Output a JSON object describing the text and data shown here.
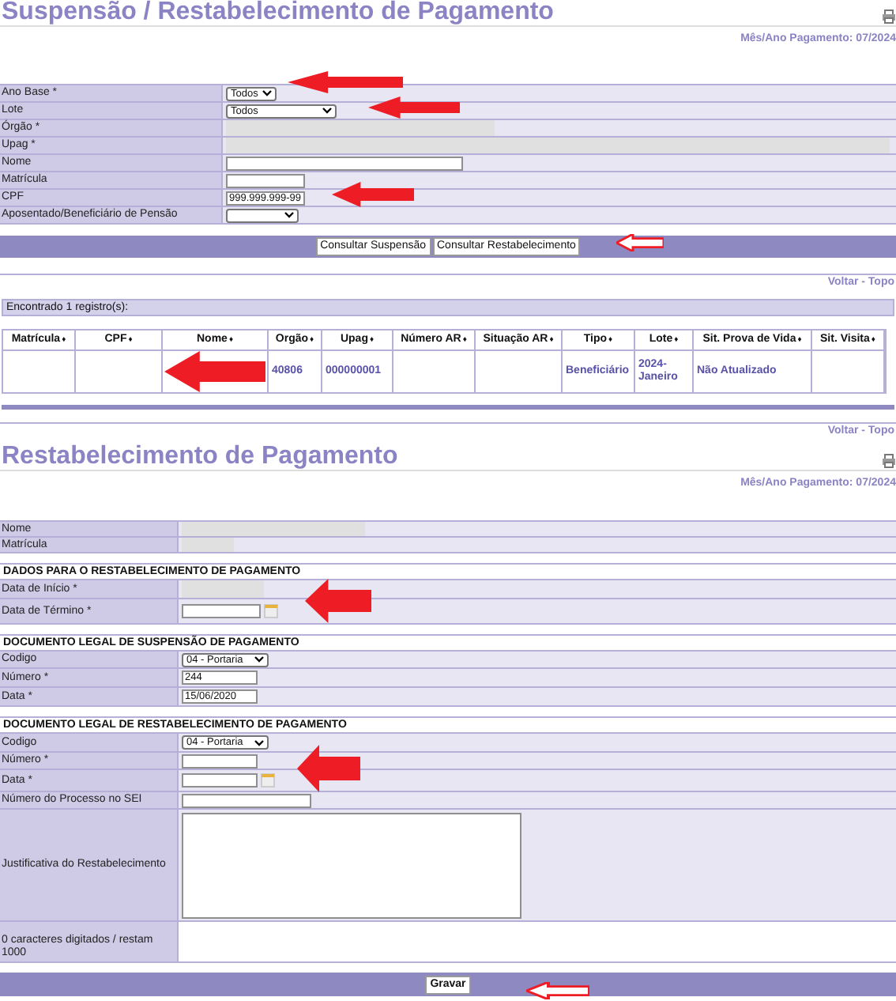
{
  "title": "Suspensão / Restabelecimento de Pagamento",
  "period": "Mês/Ano Pagamento: 07/2024",
  "filter_form": {
    "rows": [
      {
        "label": "Ano Base *",
        "kind": "select",
        "value": "Todos"
      },
      {
        "label": "Lote",
        "kind": "select",
        "value": "Todos"
      },
      {
        "label": "Órgão *",
        "kind": "readonly"
      },
      {
        "label": "Upag *",
        "kind": "readonly"
      },
      {
        "label": "Nome",
        "kind": "text"
      },
      {
        "label": "Matrícula",
        "kind": "text"
      },
      {
        "label": "CPF",
        "kind": "text",
        "value": "999.999.999-99"
      },
      {
        "label": "Aposentado/Beneficiário de Pensão",
        "kind": "select"
      }
    ]
  },
  "search_buttons": [
    "Consultar Suspensão",
    "Consultar Restabelecimento"
  ],
  "back_link_1": "Voltar - Topo",
  "results": {
    "count_text": "Encontrado 1 registro(s):",
    "columns": [
      "Matrícula",
      "CPF",
      "Nome",
      "Orgão",
      "Upag",
      "Número AR",
      "Situação AR",
      "Tipo",
      "Lote",
      "Sit. Prova de Vida",
      "Sit. Visita"
    ],
    "rows": [
      {
        "cells": [
          null,
          null,
          null,
          "40806",
          "000000001",
          null,
          null,
          "Beneficiário",
          "2024-Janeiro",
          "Não Atualizado",
          null
        ]
      }
    ]
  },
  "sort_mark": "♦",
  "back_link_2": "Voltar - Topo",
  "restore_title": "Restabelecimento de Pagamento",
  "restore_period": "Mês/Ano Pagamento: 07/2024",
  "person": {
    "rows": [
      {
        "label": "Nome",
        "kind": "readonly"
      },
      {
        "label": "Matrícula",
        "kind": "readonly"
      }
    ]
  },
  "sections": [
    {
      "heading": "DADOS PARA O RESTABELECIMENTO DE PAGAMENTO",
      "rows": [
        {
          "label": "Data de Início *",
          "kind": "readonly"
        },
        {
          "label": "Data de Término *",
          "kind": "date"
        }
      ]
    },
    {
      "heading": "DOCUMENTO LEGAL DE SUSPENSÃO DE PAGAMENTO",
      "rows": [
        {
          "label": "Codigo",
          "kind": "select",
          "value": "04 - Portaria"
        },
        {
          "label": "Número *",
          "kind": "text",
          "value": "244"
        },
        {
          "label": "Data *",
          "kind": "text",
          "value": "15/06/2020"
        }
      ]
    },
    {
      "heading": "DOCUMENTO LEGAL DE RESTABELECIMENTO DE PAGAMENTO",
      "rows": [
        {
          "label": "Codigo",
          "kind": "select",
          "value": "04 - Portaria"
        },
        {
          "label": "Número *",
          "kind": "text"
        },
        {
          "label": "Data *",
          "kind": "date"
        },
        {
          "label": "Número do Processo no SEI",
          "kind": "text"
        },
        {
          "label": "Justificativa do Restabelecimento",
          "kind": "textarea"
        },
        {
          "label": "0 caracteres digitados / restam 1000",
          "kind": "note"
        }
      ]
    }
  ],
  "save_button": "Gravar"
}
